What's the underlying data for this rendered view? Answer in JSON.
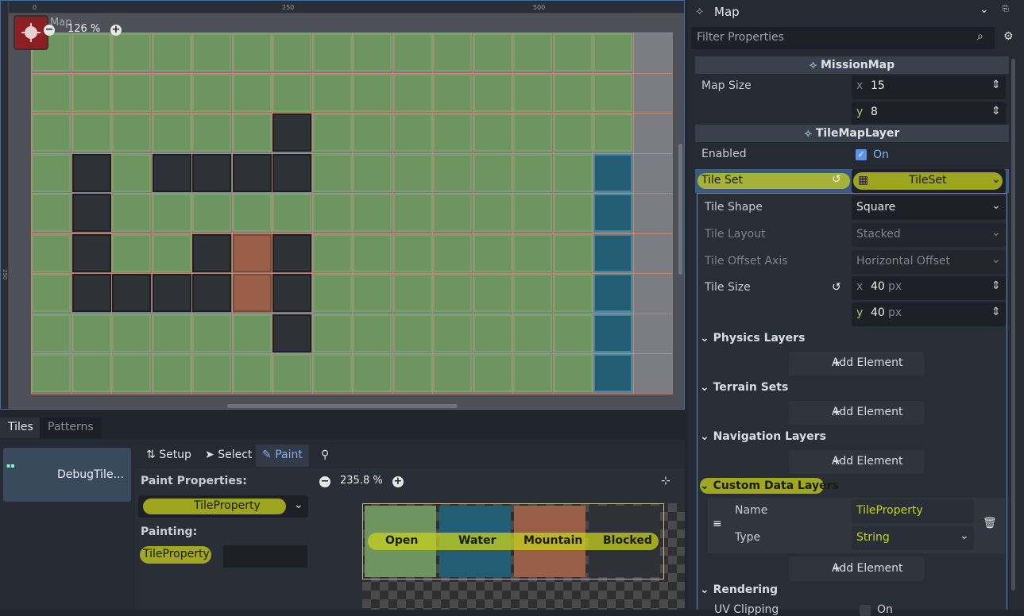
{
  "viewport": {
    "ruler_ticks": [
      "0",
      "250",
      "500"
    ],
    "ruler_left_tick": "250",
    "map_label": "Map",
    "zoom": "126 %",
    "grid": [
      "GGGGGGGGGGGGGGG",
      "GGGGGGGGGGGGGGG",
      "GGGGGGDGGGGGGGG",
      "GDGDDDDGGGGGGGB",
      "GDGGGGGGGGGGGGB",
      "GDGGDMDGGGGGGGB",
      "GDDDDMDGGGGGGGB",
      "GGGGGGDGGGGGGGB",
      "GGGGGGGGGGGGGGB"
    ]
  },
  "bottom": {
    "tabs": [
      "Tiles",
      "Patterns"
    ],
    "tile_source": "DebugTile...",
    "tools": {
      "setup": "Setup",
      "select": "Select",
      "paint": "Paint"
    },
    "paint_properties_label": "Paint Properties:",
    "paint_property_value": "TileProperty",
    "painting_label": "Painting:",
    "painting_value": "TileProperty",
    "atlas_zoom": "235.8 %",
    "atlas_tiles": [
      "Open",
      "Water",
      "Mountain",
      "Blocked"
    ]
  },
  "inspector": {
    "node_name": "Map",
    "filter_placeholder": "Filter Properties",
    "mission_map": "MissionMap",
    "map_size_label": "Map Size",
    "map_size_x": "15",
    "map_size_y": "8",
    "tilemaplayer": "TileMapLayer",
    "enabled_label": "Enabled",
    "enabled_value": "On",
    "tile_set_label": "Tile Set",
    "tile_set_value": "TileSet",
    "tile_shape_label": "Tile Shape",
    "tile_shape_value": "Square",
    "tile_layout_label": "Tile Layout",
    "tile_layout_value": "Stacked",
    "tile_offset_axis_label": "Tile Offset Axis",
    "tile_offset_axis_value": "Horizontal Offset",
    "tile_size_label": "Tile Size",
    "tile_size_x": "40",
    "tile_size_y": "40",
    "unit_px": "px",
    "axis_x": "x",
    "axis_y": "y",
    "physics_layers": "Physics Layers",
    "terrain_sets": "Terrain Sets",
    "navigation_layers": "Navigation Layers",
    "custom_data_layers": "Custom Data Layers",
    "add_element": "Add Element",
    "cd_name_label": "Name",
    "cd_name_value": "TileProperty",
    "cd_type_label": "Type",
    "cd_type_value": "String",
    "rendering": "Rendering",
    "uv_clipping_label": "UV Clipping",
    "uv_clipping_value": "On"
  },
  "colors": {
    "accent": "#7fb2ef",
    "highlight": "#c8d21e",
    "grass": "#6e9460",
    "water": "#225d73",
    "mountain": "#9a5f48",
    "blocked": "#2e3237"
  }
}
